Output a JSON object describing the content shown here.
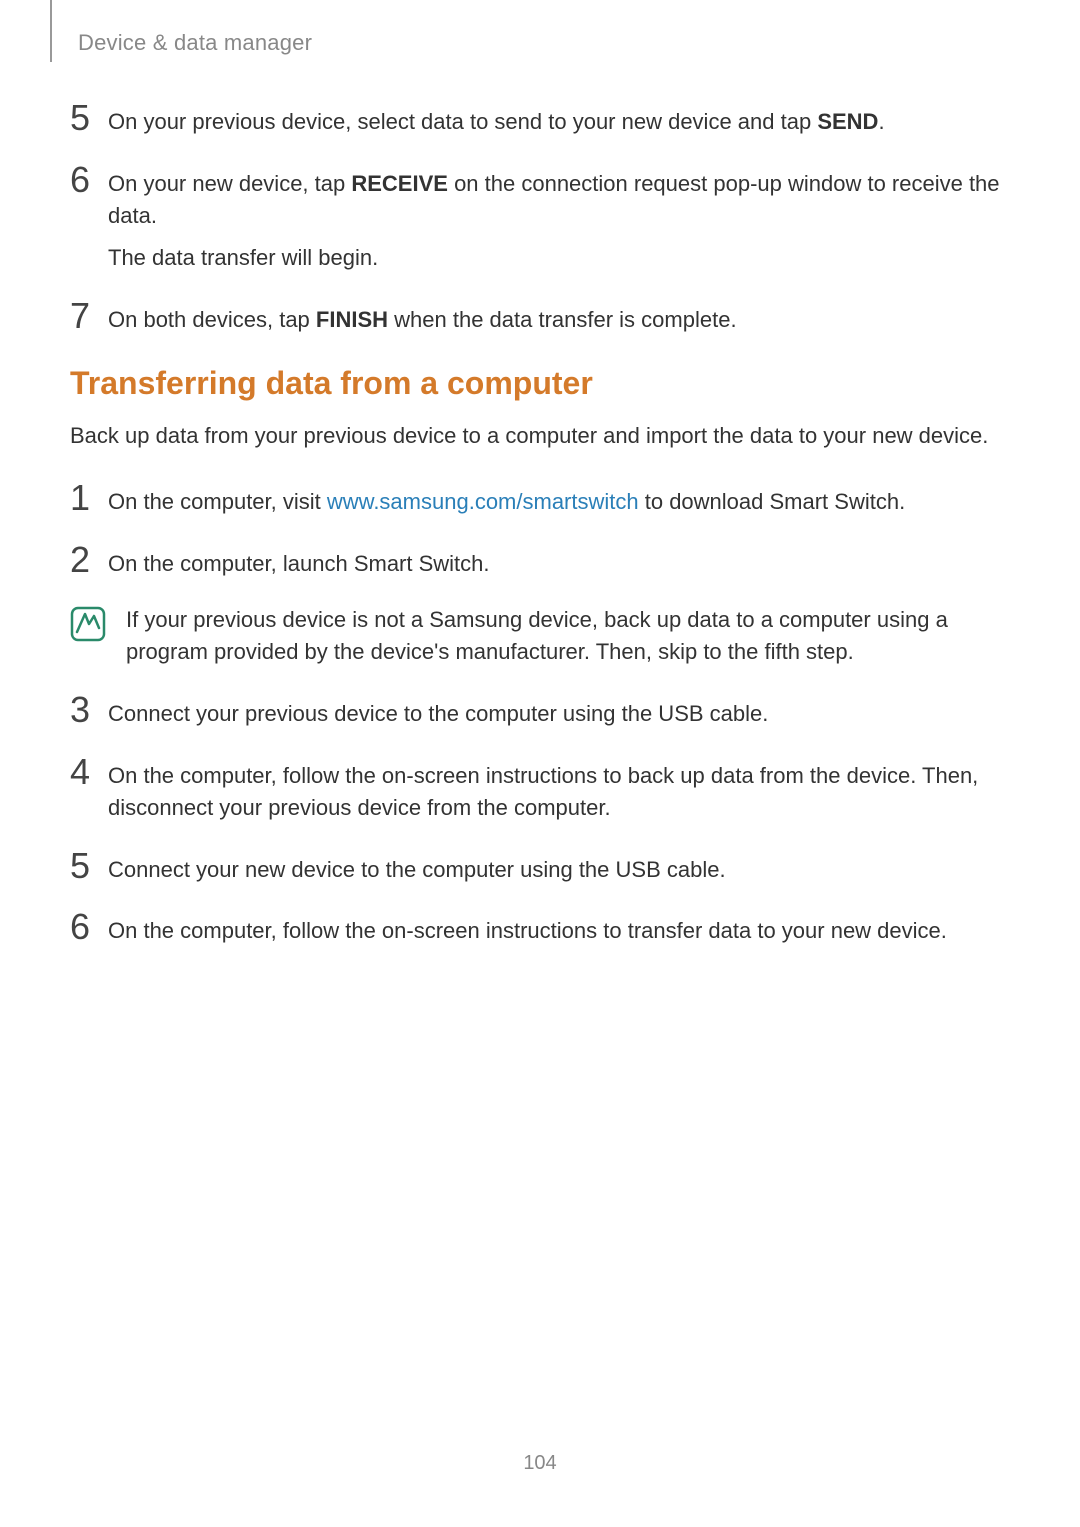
{
  "header": {
    "title": "Device & data manager"
  },
  "steps_top": [
    {
      "num": "5",
      "parts": [
        {
          "t": "On your previous device, select data to send to your new device and tap "
        },
        {
          "t": "SEND",
          "bold": true
        },
        {
          "t": "."
        }
      ]
    },
    {
      "num": "6",
      "lines": [
        [
          {
            "t": "On your new device, tap "
          },
          {
            "t": "RECEIVE",
            "bold": true
          },
          {
            "t": " on the connection request pop-up window to receive the data."
          }
        ],
        [
          {
            "t": "The data transfer will begin."
          }
        ]
      ]
    },
    {
      "num": "7",
      "parts": [
        {
          "t": "On both devices, tap "
        },
        {
          "t": "FINISH",
          "bold": true
        },
        {
          "t": " when the data transfer is complete."
        }
      ]
    }
  ],
  "section": {
    "heading": "Transferring data from a computer",
    "intro": "Back up data from your previous device to a computer and import the data to your new device."
  },
  "steps_bottom": [
    {
      "num": "1",
      "parts": [
        {
          "t": "On the computer, visit "
        },
        {
          "t": "www.samsung.com/smartswitch",
          "link": true
        },
        {
          "t": " to download Smart Switch."
        }
      ]
    },
    {
      "num": "2",
      "parts": [
        {
          "t": "On the computer, launch Smart Switch."
        }
      ]
    }
  ],
  "note": {
    "text": "If your previous device is not a Samsung device, back up data to a computer using a program provided by the device's manufacturer. Then, skip to the fifth step."
  },
  "steps_after_note": [
    {
      "num": "3",
      "parts": [
        {
          "t": "Connect your previous device to the computer using the USB cable."
        }
      ]
    },
    {
      "num": "4",
      "parts": [
        {
          "t": "On the computer, follow the on-screen instructions to back up data from the device. Then, disconnect your previous device from the computer."
        }
      ]
    },
    {
      "num": "5",
      "parts": [
        {
          "t": "Connect your new device to the computer using the USB cable."
        }
      ]
    },
    {
      "num": "6",
      "parts": [
        {
          "t": "On the computer, follow the on-screen instructions to transfer data to your new device."
        }
      ]
    }
  ],
  "page_number": "104"
}
